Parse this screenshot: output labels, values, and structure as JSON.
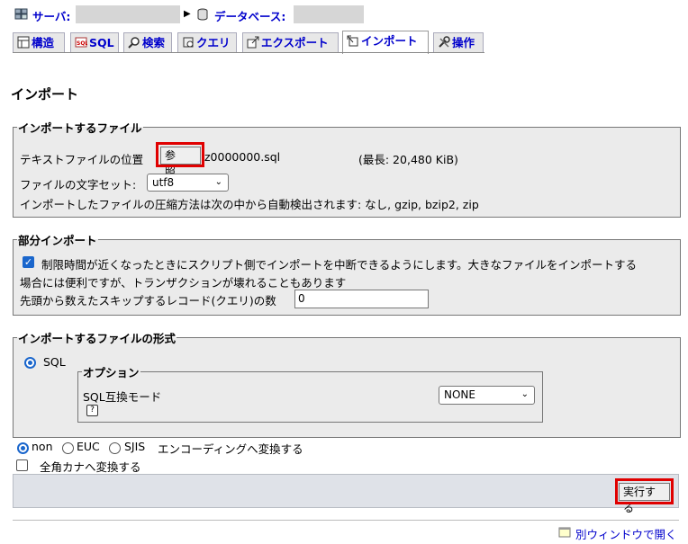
{
  "breadcrumb": {
    "server_label": "サーバ:",
    "database_label": "データベース:"
  },
  "tabs": [
    {
      "label": "構造",
      "icon": "structure-icon"
    },
    {
      "label": "SQL",
      "icon": "sql-icon"
    },
    {
      "label": "検索",
      "icon": "search-icon"
    },
    {
      "label": "クエリ",
      "icon": "query-icon"
    },
    {
      "label": "エクスポート",
      "icon": "export-icon"
    },
    {
      "label": "インポート",
      "icon": "import-icon",
      "active": true
    },
    {
      "label": "操作",
      "icon": "operations-icon"
    }
  ],
  "page_title": "インポート",
  "import_file": {
    "legend": "インポートするファイル",
    "file_location_label": "テキストファイルの位置",
    "browse_button": "参照...",
    "file_name": "z0000000.sql",
    "max_size": "(最長: 20,480 KiB)",
    "charset_label": "ファイルの文字セット:",
    "charset_value": "utf8",
    "compression_note": "インポートしたファイルの圧縮方法は次の中から自動検出されます: なし, gzip, bzip2, zip"
  },
  "partial_import": {
    "legend": "部分インポート",
    "allow_interrupt_line1": "制限時間が近くなったときにスクリプト側でインポートを中断できるようにします。大きなファイルをインポートする",
    "allow_interrupt_line2": "場合には便利ですが、トランザクションが壊れることもあります",
    "allow_interrupt_checked": true,
    "skip_label": "先頭から数えたスキップするレコード(クエリ)の数",
    "skip_value": "0"
  },
  "format": {
    "legend": "インポートするファイルの形式",
    "sql_label": "SQL",
    "options_legend": "オプション",
    "compat_label": "SQL互換モード",
    "compat_value": "NONE",
    "help_icon": "help-icon"
  },
  "encoding": {
    "options": [
      "non",
      "EUC",
      "SJIS"
    ],
    "selected": "non",
    "label": "エンコーディングへ変換する",
    "kana_label": "全角カナへ変換する",
    "kana_checked": false
  },
  "submit_button": "実行する",
  "new_window_link": "別ウィンドウで開く",
  "colors": {
    "link": "#0000cc",
    "highlight": "#e00000",
    "panel": "#ebebeb",
    "footer_bar": "#dfe2e8"
  }
}
